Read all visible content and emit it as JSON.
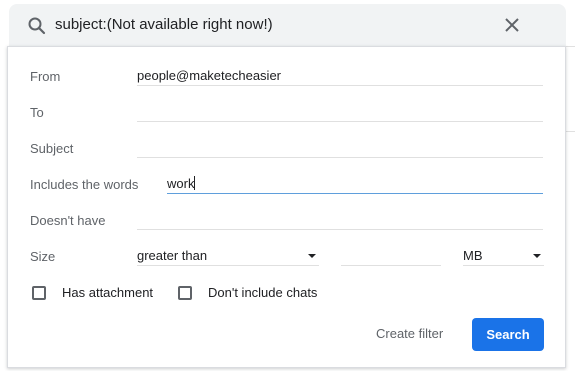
{
  "search": {
    "query": "subject:(Not available right now!)",
    "search_icon": "search-icon",
    "clear_icon": "close-icon"
  },
  "form": {
    "from_label": "From",
    "from_value": "people@maketecheasier",
    "to_label": "To",
    "to_value": "",
    "subject_label": "Subject",
    "subject_value": "",
    "includes_label": "Includes the words",
    "includes_value": "work",
    "doesnt_label": "Doesn't have",
    "doesnt_value": "",
    "size_label": "Size",
    "size_comparator": "greater than",
    "size_value": "",
    "size_unit": "MB"
  },
  "checkboxes": {
    "has_attachment": "Has attachment",
    "dont_include_chats": "Don't include chats"
  },
  "actions": {
    "create_filter": "Create filter",
    "search": "Search"
  },
  "colors": {
    "primary": "#1a73e8",
    "searchbar_bg": "#f1f3f4",
    "focus_underline": "#5f9fdc"
  }
}
